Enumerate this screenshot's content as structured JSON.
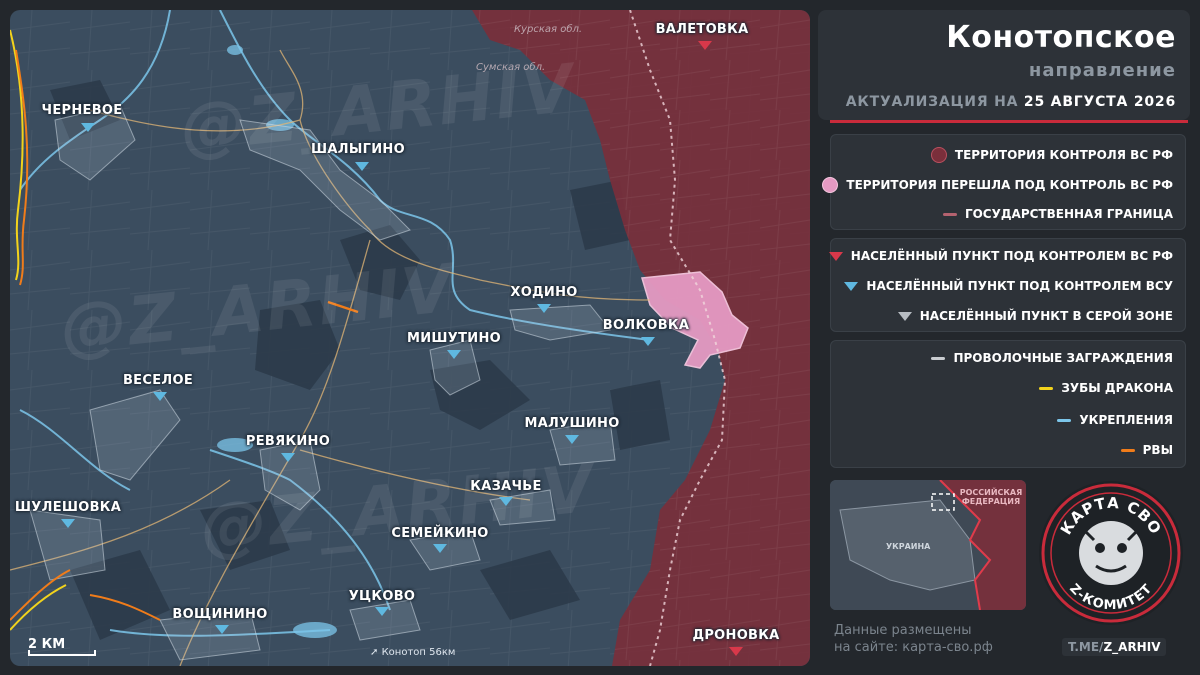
{
  "header": {
    "title": "Конотопское",
    "subtitle": "направление",
    "update_prefix": "АКТУАЛИЗАЦИЯ НА",
    "update_date": "25 АВГУСТА 2026"
  },
  "legend": {
    "territory": [
      {
        "label": "ТЕРРИТОРИЯ КОНТРОЛЯ ВС РФ",
        "color": "#7a2f3b"
      },
      {
        "label": "ТЕРРИТОРИЯ ПЕРЕШЛА ПОД КОНТРОЛЬ ВС РФ",
        "color": "#e59ac3"
      },
      {
        "label": "ГОСУДАРСТВЕННАЯ ГРАНИЦА",
        "color": "#b4626f"
      }
    ],
    "settlements": [
      {
        "label": "НАСЕЛЁННЫЙ ПУНКТ ПОД КОНТРОЛЕМ ВС РФ",
        "color": "#d8384a"
      },
      {
        "label": "НАСЕЛЁННЫЙ ПУНКТ ПОД КОНТРОЛЕМ ВСУ",
        "color": "#5fb8e0"
      },
      {
        "label": "НАСЕЛЁННЫЙ ПУНКТ В СЕРОЙ ЗОНЕ",
        "color": "#b7bcc2"
      }
    ],
    "fortifications": [
      {
        "label": "ПРОВОЛОЧНЫЕ ЗАГРАЖДЕНИЯ",
        "color": "#c9ccd0"
      },
      {
        "label": "ЗУБЫ ДРАКОНА",
        "color": "#f2d31c"
      },
      {
        "label": "УКРЕПЛЕНИЯ",
        "color": "#7cc6ea"
      },
      {
        "label": "РВЫ",
        "color": "#f07c1a"
      }
    ]
  },
  "map": {
    "settlements": [
      {
        "name": "ЧЕРНЕВОЕ",
        "control": "ua"
      },
      {
        "name": "ШАЛЫГИНО",
        "control": "ua"
      },
      {
        "name": "ВАЛЕТОВКА",
        "control": "ru"
      },
      {
        "name": "ХОДИНО",
        "control": "ua"
      },
      {
        "name": "ВОЛКОВКА",
        "control": "ua"
      },
      {
        "name": "МИШУТИНО",
        "control": "ua"
      },
      {
        "name": "ВЕСЕЛОЕ",
        "control": "ua"
      },
      {
        "name": "МАЛУШИНО",
        "control": "ua"
      },
      {
        "name": "РЕВЯКИНО",
        "control": "ua"
      },
      {
        "name": "КАЗАЧЬЕ",
        "control": "ua"
      },
      {
        "name": "ШУЛЕШОВКА",
        "control": "ua"
      },
      {
        "name": "СЕМЕЙКИНО",
        "control": "ua"
      },
      {
        "name": "УЦКОВО",
        "control": "ua"
      },
      {
        "name": "ВОЩИНИНО",
        "control": "ua"
      },
      {
        "name": "ДРОНОВКА",
        "control": "ru"
      }
    ],
    "region_labels": [
      "Курская обл.",
      "Сумская обл."
    ],
    "watermark": "@Z_ARHIV",
    "scale": "2 КМ",
    "road_note": "Конотоп 56км"
  },
  "inset": {
    "ru_label": "РОССИЙСКАЯ ФЕДЕРАЦИЯ",
    "ua_label": "УКРАИНА"
  },
  "emblem": {
    "top_text": "КАРТА СВО",
    "bottom_text": "Z-КОМИТЕТ"
  },
  "footer": {
    "line1": "Данные размещены",
    "line2": "на сайте: карта-сво.рф",
    "tme_prefix": "T.ME/",
    "tme_handle": "Z_ARHIV"
  },
  "colors": {
    "ua_territory": "#3b4d5f",
    "ru_territory": "#7a2f3b",
    "accent_red": "#c92b3b"
  }
}
